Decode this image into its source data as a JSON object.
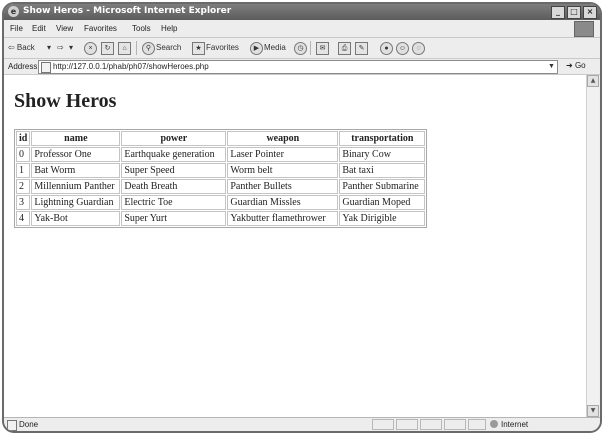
{
  "window": {
    "title": "Show Heros - Microsoft Internet Explorer",
    "min": "_",
    "max": "□",
    "close": "×"
  },
  "menu": [
    "File",
    "Edit",
    "View",
    "Favorites",
    "Tools",
    "Help"
  ],
  "toolbar": {
    "back": "⇦ Back",
    "back_dd": "▾",
    "forward": "⇨",
    "forward_dd": "▾",
    "search": "Search",
    "favorites": "Favorites",
    "media": "Media"
  },
  "address": {
    "label": "Address",
    "url": "http://127.0.0.1/phab/ph07/showHeroes.php",
    "go": "Go"
  },
  "page": {
    "heading": "Show Heros",
    "table": {
      "headers": [
        "id",
        "name",
        "power",
        "weapon",
        "transportation"
      ],
      "rows": [
        [
          "0",
          "Professor One",
          "Earthquake generation",
          "Laser Pointer",
          "Binary Cow"
        ],
        [
          "1",
          "Bat Worm",
          "Super Speed",
          "Worm belt",
          "Bat taxi"
        ],
        [
          "2",
          "Millennium Panther",
          "Death Breath",
          "Panther Bullets",
          "Panther Submarine"
        ],
        [
          "3",
          "Lightning Guardian",
          "Electric Toe",
          "Guardian Missles",
          "Guardian Moped"
        ],
        [
          "4",
          "Yak-Bot",
          "Super Yurt",
          "Yakbutter flamethrower",
          "Yak Dirigible"
        ]
      ]
    }
  },
  "status": {
    "text": "Done",
    "zone": "Internet"
  }
}
